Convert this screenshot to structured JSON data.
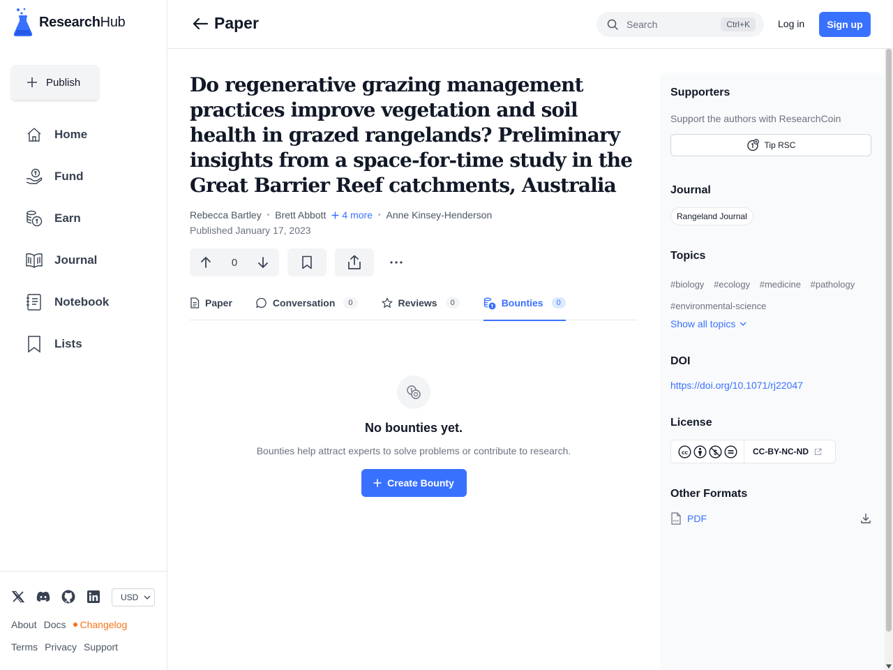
{
  "brand": {
    "name_bold": "Research",
    "name_light": "Hub"
  },
  "sidebar": {
    "publish_label": "Publish",
    "items": [
      {
        "label": "Home",
        "icon": "home-icon"
      },
      {
        "label": "Fund",
        "icon": "fund-icon"
      },
      {
        "label": "Earn",
        "icon": "earn-icon"
      },
      {
        "label": "Journal",
        "icon": "journal-icon"
      },
      {
        "label": "Notebook",
        "icon": "notebook-icon"
      },
      {
        "label": "Lists",
        "icon": "bookmark-icon"
      }
    ],
    "currency": "USD",
    "links": {
      "about": "About",
      "docs": "Docs",
      "changelog": "Changelog",
      "terms": "Terms",
      "privacy": "Privacy",
      "support": "Support"
    }
  },
  "header": {
    "back_label": "Paper",
    "search_placeholder": "Search",
    "search_shortcut": "Ctrl+K",
    "login": "Log in",
    "signup": "Sign up"
  },
  "paper": {
    "title": "Do regenerative grazing management practices improve vegetation and soil health in grazed rangelands? Preliminary insights from a space-for-time study in the Great Barrier Reef catchments, Australia",
    "authors": [
      "Rebecca Bartley",
      "Brett Abbott",
      "Anne Kinsey-Henderson"
    ],
    "more_authors": "4 more",
    "published": "Published January 17, 2023",
    "votes": "0"
  },
  "tabs": [
    {
      "label": "Paper"
    },
    {
      "label": "Conversation",
      "count": "0"
    },
    {
      "label": "Reviews",
      "count": "0"
    },
    {
      "label": "Bounties",
      "count": "0"
    }
  ],
  "empty_state": {
    "title": "No bounties yet.",
    "text": "Bounties help attract experts to solve problems or contribute to research.",
    "button": "Create Bounty"
  },
  "right_panel": {
    "supporters_title": "Supporters",
    "supporters_text": "Support the authors with ResearchCoin",
    "tip_label": "Tip RSC",
    "journal_title": "Journal",
    "journal_name": "Rangeland Journal",
    "topics_title": "Topics",
    "topics": [
      "#biology",
      "#ecology",
      "#medicine",
      "#pathology",
      "#environmental-science"
    ],
    "show_topics": "Show all topics",
    "doi_title": "DOI",
    "doi": "https://doi.org/10.1071/rj22047",
    "license_title": "License",
    "license": "CC-BY-NC-ND",
    "formats_title": "Other Formats",
    "pdf": "PDF"
  },
  "colors": {
    "accent": "#3971ff",
    "changelog": "#f97316"
  }
}
